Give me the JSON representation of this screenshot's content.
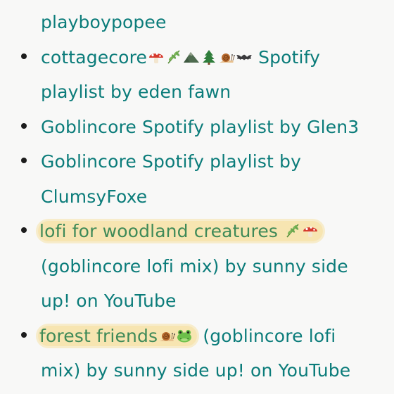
{
  "items": [
    {
      "continued": true,
      "text": "playboypopee"
    },
    {
      "lead": "cottagecore",
      "icons": [
        "mushroom-icon",
        "herb-icon",
        "mountain-icon",
        "evergreen-tree-icon",
        "snail-icon",
        "bat-icon"
      ],
      "tail": " Spotify playlist by eden fawn"
    },
    {
      "text": "Goblincore Spotify playlist by Glen3"
    },
    {
      "text": "Goblincore Spotify playlist by ClumsyFoxe"
    },
    {
      "highlight": "lofi for woodland creatures ",
      "icons": [
        "herb-icon",
        "mushroom-icon"
      ],
      "tail": " (goblincore lofi mix) by sunny side up! on YouTube"
    },
    {
      "highlight": "forest friends",
      "icons": [
        "snail-icon",
        "frog-icon"
      ],
      "tail": " (goblincore lofi mix) by sunny side up! on YouTube"
    }
  ],
  "colors": {
    "link": "#0b7c7a",
    "highlight_bg": "#f6d678",
    "highlight_text": "#3f8a58",
    "bullet": "#1c1c1c",
    "page_bg": "#f8f8f7"
  }
}
